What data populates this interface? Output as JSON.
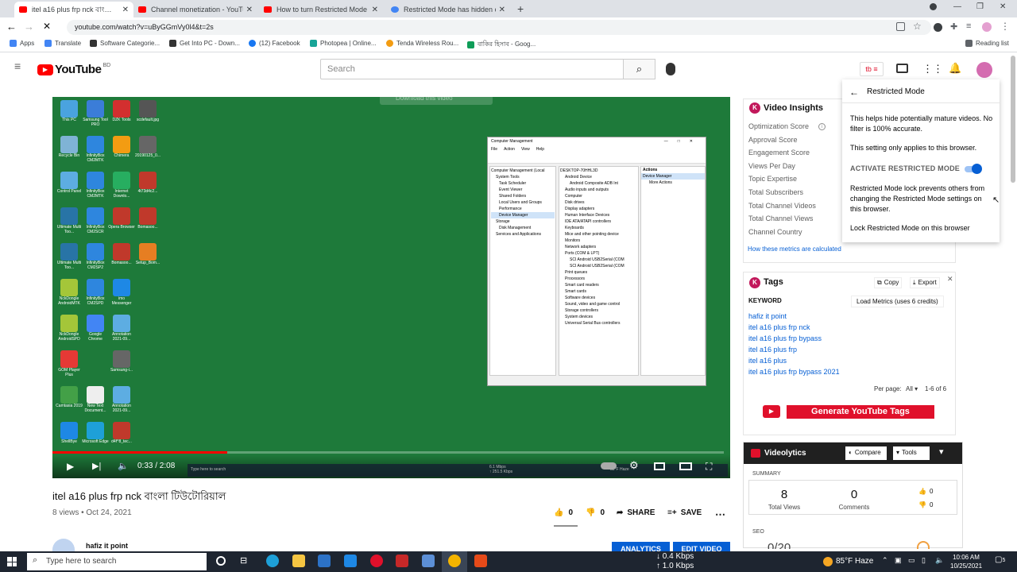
{
  "browser": {
    "tabs": [
      {
        "title": "itel a16 plus frp nck বাংলা টিউটোরিয়াল",
        "active": true
      },
      {
        "title": "Channel monetization - YouTube"
      },
      {
        "title": "How to turn Restricted Mode on"
      },
      {
        "title": "Restricted Mode has hidden con"
      }
    ],
    "url": "youtube.com/watch?v=uByGGmVy0l4&t=2s",
    "bookmarks": [
      "Apps",
      "Translate",
      "Software Categorie...",
      "Get Into PC - Down...",
      "(12) Facebook",
      "Photopea | Online...",
      "Tenda Wireless Rou...",
      "বাকির হিসাব - Goog..."
    ],
    "reading_list": "Reading list"
  },
  "youtube": {
    "logo_text": "YouTube",
    "country": "BD",
    "search_placeholder": "Search"
  },
  "video": {
    "download_overlay": "Download this video",
    "time": "0:33 / 2:08",
    "progress_fraction": 0.26,
    "desktop_icons": [
      "This PC",
      "Samsung Tool PRO",
      "DZK Tools",
      "scdefault.jpg",
      "Recycle Bin",
      "InfinityBox CM2MTK",
      "Chimera",
      "20190125_0...",
      "Control Panel",
      "InfinityBox CM2MTK",
      "Internet Downlo...",
      "4t73d4c2...",
      "Ultimate Multi Too...",
      "InfinityBox CM2SCR",
      "Opera Browser",
      "Bomasoo...",
      "Ultimate Multi Too...",
      "InfinityBox CM2SP2",
      "Bomasoo...",
      "Setup_Bom...",
      "NckDongle AndroidMTK",
      "InfinityBox CM2SPD",
      "imo Messenger",
      "",
      "NckDongle AndroidSPD",
      "Google Chrome",
      "Annotation 2021-09...",
      "",
      "GOM Player Plus",
      "",
      "Samsung-i...",
      "",
      "Camtasia 2019",
      "New Text Document...",
      "Annotation 2021-09...",
      "",
      "ShellBye",
      "Microsoft Edge",
      "d4f^8_tec...",
      ""
    ],
    "cm_title": "Computer Management",
    "cm_menu": [
      "File",
      "Action",
      "View",
      "Help"
    ],
    "cm_tree": [
      "Computer Management (Local",
      "System Tools",
      "Task Scheduler",
      "Event Viewer",
      "Shared Folders",
      "Local Users and Groups",
      "Performance",
      "Device Manager",
      "Storage",
      "Disk Management",
      "Services and Applications"
    ],
    "cm_devices": [
      "DESKTOP-70HHL3D",
      "Android Device",
      "Android Composite ADB Int",
      "Audio inputs and outputs",
      "Computer",
      "Disk drives",
      "Display adapters",
      "Human Interface Devices",
      "IDE ATA/ATAPI controllers",
      "Keyboards",
      "Mice and other pointing device",
      "Monitors",
      "Network adapters",
      "Ports (COM & LPT)",
      "SCI Android USB2Serial (COM",
      "SCI Android USB2Serial (COM",
      "Print queues",
      "Processors",
      "Smart card readers",
      "Smart cards",
      "Software devices",
      "Sound, video and game control",
      "Storage controllers",
      "System devices",
      "Universal Serial Bus controllers"
    ],
    "cm_actions_header": "Actions",
    "cm_actions": [
      "Device Manager",
      "More Actions"
    ],
    "inner_taskbar_search": "Type here to search",
    "inner_net": "6.1 Mbps\n↑ 251.5 Kbps",
    "inner_weather": "82°F Haze"
  },
  "below_video": {
    "title": "itel a16 plus frp nck বাংলা টিউটোরিয়াল",
    "meta": "8 views • Oct 24, 2021",
    "likes": "0",
    "dislikes": "0",
    "share": "SHARE",
    "save": "SAVE",
    "channel": "hafiz it point",
    "analytics": "ANALYTICS",
    "edit": "EDIT VIDEO"
  },
  "insights": {
    "title": "Video Insights",
    "rows": [
      "Optimization Score",
      "Approval Score",
      "Engagement Score",
      "Views Per Day",
      "Topic Expertise",
      "Total Subscribers",
      "Total Channel Videos",
      "Total Channel Views",
      "Channel Country"
    ],
    "link": "How these metrics are calculated"
  },
  "restricted": {
    "title": "Restricted Mode",
    "p1": "This helps hide potentially mature videos. No filter is 100% accurate.",
    "p2": "This setting only applies to this browser.",
    "activate": "ACTIVATE RESTRICTED MODE",
    "p3": "Restricted Mode lock prevents others from changing the Restricted Mode settings on this browser.",
    "lock": "Lock Restricted Mode on this browser"
  },
  "tags": {
    "title": "Tags",
    "copy": "Copy",
    "export": "Export",
    "keyword": "KEYWORD",
    "load": "Load Metrics (uses 6 credits)",
    "items": [
      "hafiz it point",
      "itel a16 plus frp nck",
      "itel a16 plus frp bypass",
      "itel a16 plus frp",
      "itel a16 plus",
      "itel a16 plus frp bypass 2021"
    ],
    "per_page": "Per page:",
    "per_page_val": "All",
    "range": "1-6 of 6",
    "generate": "Generate YouTube Tags"
  },
  "videolytics": {
    "title": "Videolytics",
    "compare": "Compare",
    "tools": "Tools",
    "summary": "SUMMARY",
    "views": "8",
    "views_label": "Total Views",
    "comments": "0",
    "comments_label": "Comments",
    "likes": "0",
    "dislikes": "0",
    "seo": "SEO",
    "seo_score": "0/20"
  },
  "taskbar": {
    "search": "Type here to search",
    "net_down": "↓ 0.4 Kbps",
    "net_up": "↑ 1.0 Kbps",
    "weather": "85°F Haze",
    "time": "10:06 AM",
    "date": "10/25/2021",
    "notif": "5"
  },
  "colors": {
    "yt_red": "#ff0000",
    "link": "#065fd4",
    "brand_red": "#e0102b",
    "video_bg": "#1e7a3a"
  }
}
